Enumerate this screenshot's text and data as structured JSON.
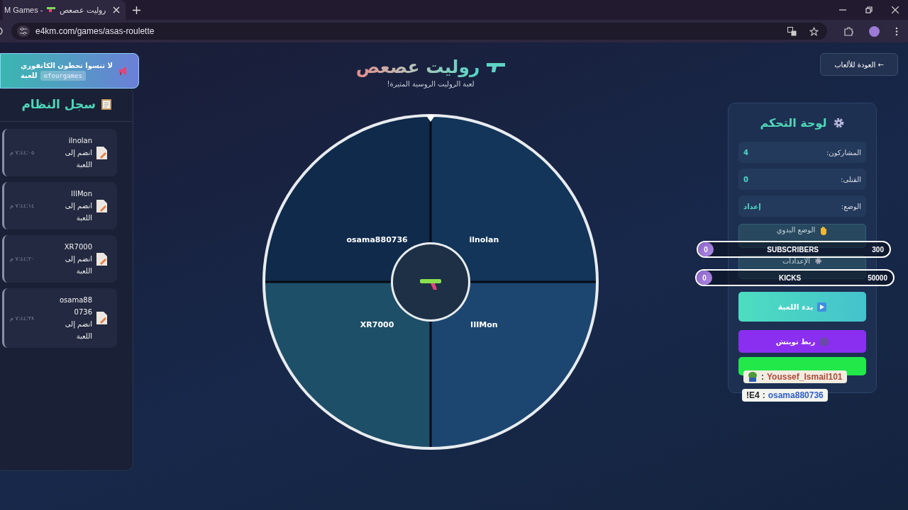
{
  "browser": {
    "tab_title": "روليت عصعص",
    "tab_suffix": "M Games -",
    "url": "e4km.com/games/asas-roulette"
  },
  "banner": {
    "text": "لا تنسوا تحطون الكاتقوري",
    "code": "efourgames",
    "text_after": "للعبة"
  },
  "log": {
    "title": "سجل النظام",
    "entries": [
      {
        "name": "ilnolan",
        "action": "انضم إلى اللعبة",
        "time": "٧:٤٤:٠٥ م"
      },
      {
        "name": "IIIMon",
        "action": "انضم إلى اللعبة",
        "time": "٧:٤٤:١٤ م"
      },
      {
        "name": "XR7000",
        "action": "انضم إلى اللعبة",
        "time": "٧:٤٤:٢٠ م"
      },
      {
        "name": "osama880736",
        "action": "انضم إلى اللعبة",
        "time": "٧:٤٤:٣٨ م"
      }
    ]
  },
  "header": {
    "title": "روليت عصعص",
    "subtitle": "لعبة الروليت الروسية المثيرة!"
  },
  "wheel": {
    "segments": [
      {
        "name": "ilnolan",
        "color": "#123559"
      },
      {
        "name": "IIIMon",
        "color": "#1c4670"
      },
      {
        "name": "XR7000",
        "color": "#1e4f68"
      },
      {
        "name": "osama880736",
        "color": "#0f2a4b"
      }
    ]
  },
  "back_button": "← العودة للألعاب",
  "control_panel": {
    "title": "لوحة التحكم",
    "stats": [
      {
        "label": "المشاركون:",
        "value": "4"
      },
      {
        "label": "القتلى:",
        "value": "0"
      },
      {
        "label": "الوضع:",
        "value": "إعداد"
      }
    ],
    "buttons": [
      {
        "kind": "manual",
        "label": "الوضع اليدوي"
      },
      {
        "kind": "settings",
        "label": "الإعدادات"
      },
      {
        "kind": "start",
        "label": "بدء اللعبة"
      },
      {
        "kind": "twitch",
        "label": "ربط تويتش"
      },
      {
        "kind": "green"
      }
    ]
  },
  "goals": [
    {
      "label": "SUBSCRIBERS",
      "current": "0",
      "target": "300",
      "level": 0
    },
    {
      "label": "KICKS",
      "current": "0",
      "target": "50000",
      "level": 0
    }
  ],
  "chat": [
    {
      "user": "Youssef_Ismail101",
      "separator": ":",
      "avatar": true
    },
    {
      "user": "osama880736",
      "separator": ":",
      "message": "!E4"
    }
  ]
}
